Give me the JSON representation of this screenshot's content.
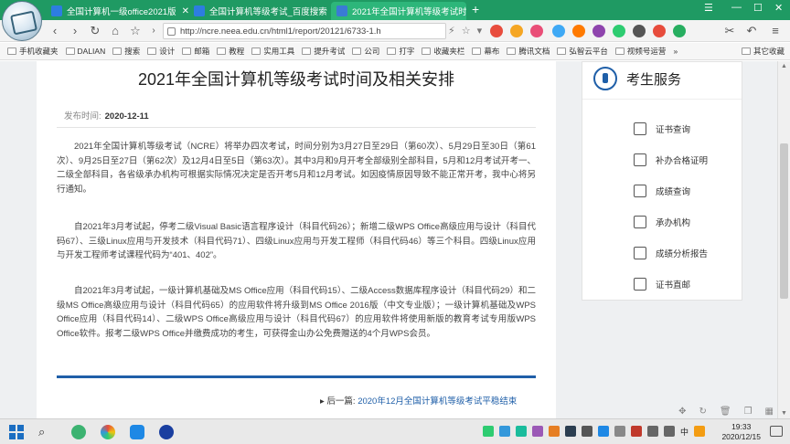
{
  "browser": {
    "tabs": [
      {
        "title": "全国计算机一级office2021版",
        "active": false,
        "favicon_color": "#2d7de0"
      },
      {
        "title": "全国计算机等级考试_百度搜索",
        "active": false,
        "favicon_color": "#2d7de0"
      },
      {
        "title": "2021年全国计算机等级考试时间",
        "active": true,
        "favicon_color": "#3a7bd5"
      }
    ],
    "new_tab": "+",
    "url": "http://ncre.neea.edu.cn/html1/report/20121/6733-1.h",
    "bookmarks": [
      "手机收藏夹",
      "DALIAN",
      "搜索",
      "设计",
      "邮箱",
      "教程",
      "实用工具",
      "提升考试",
      "公司",
      "打字",
      "收藏夹栏",
      "幕布",
      "腾讯文档",
      "弘智云平台",
      "视频号运营"
    ],
    "bookmarks_more": "»",
    "bookmarks_right": "其它收藏"
  },
  "article": {
    "title": "2021年全国计算机等级考试时间及相关安排",
    "pubdate_label": "发布时间:",
    "pubdate_value": "2020-12-11",
    "paragraphs": [
      "2021年全国计算机等级考试（NCRE）将举办四次考试，时间分别为3月27日至29日（第60次）、5月29日至30日（第61次）、9月25日至27日（第62次）及12月4日至5日（第63次）。其中3月和9月开考全部级别全部科目，5月和12月考试开考一、二级全部科目，各省级承办机构可根据实际情况决定是否开考5月和12月考试。如因疫情原因导致不能正常开考，我中心将另行通知。",
      "自2021年3月考试起，停考二级Visual Basic语言程序设计（科目代码26）；新增二级WPS Office高级应用与设计（科目代码67）、三级Linux应用与开发技术（科目代码71）、四级Linux应用与开发工程师（科目代码46）等三个科目。四级Linux应用与开发工程师考试课程代码为“401、402”。",
      "自2021年3月考试起，一级计算机基础及MS Office应用（科目代码15）、二级Access数据库程序设计（科目代码29）和二级MS Office高级应用与设计（科目代码65）的应用软件将升级到MS Office 2016版（中文专业版）；一级计算机基础及WPS Office应用（科目代码14）、二级WPS Office高级应用与设计（科目代码67）的应用软件将使用新版的教育考试专用版WPS Office软件。报考二级WPS Office并缴费成功的考生，可获得金山办公免费赠送的4个月WPS会员。"
    ],
    "next_label": "后一篇:",
    "next_link": "2020年12月全国计算机等级考试平稳结束"
  },
  "sidebar": {
    "title": "考生服务",
    "items": [
      "证书查询",
      "补办合格证明",
      "成绩查询",
      "承办机构",
      "成绩分析报告",
      "证书直邮"
    ]
  },
  "taskbar": {
    "time": "19:33",
    "date": "2020/12/15",
    "ime": "中"
  },
  "colors": {
    "tab_bar": "#1f9a63",
    "active_tab": "#2db67a",
    "accent_blue": "#1f5fa8"
  }
}
